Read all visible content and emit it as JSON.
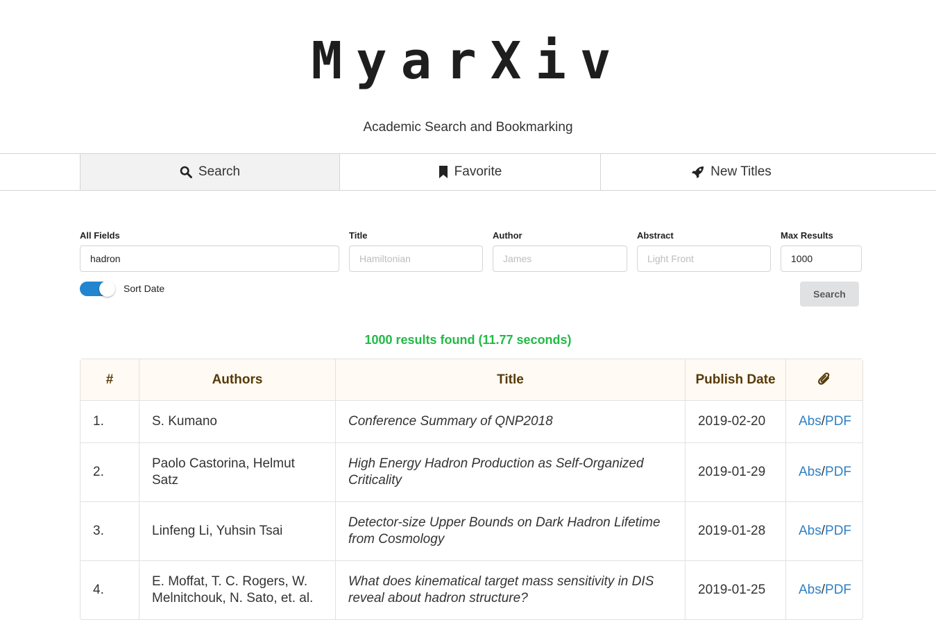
{
  "app": {
    "title": "MyarXiv",
    "tagline": "Academic Search and Bookmarking"
  },
  "nav": {
    "tabs": [
      {
        "label": "Search",
        "icon": "search-icon",
        "active": true
      },
      {
        "label": "Favorite",
        "icon": "bookmark-icon",
        "active": false
      },
      {
        "label": "New Titles",
        "icon": "rocket-icon",
        "active": false
      }
    ]
  },
  "search_form": {
    "all_fields": {
      "label": "All Fields",
      "value": "hadron",
      "placeholder": ""
    },
    "title": {
      "label": "Title",
      "value": "",
      "placeholder": "Hamiltonian"
    },
    "author": {
      "label": "Author",
      "value": "",
      "placeholder": "James"
    },
    "abstract": {
      "label": "Abstract",
      "value": "",
      "placeholder": "Light Front"
    },
    "max_results": {
      "label": "Max Results",
      "value": "1000",
      "placeholder": ""
    },
    "sort_date": {
      "label": "Sort Date",
      "enabled": true
    },
    "submit_label": "Search"
  },
  "results": {
    "status": "1000 results found (11.77 seconds)",
    "columns": [
      "#",
      "Authors",
      "Title",
      "Publish Date",
      "paperclip-icon"
    ],
    "rows": [
      {
        "num": "1.",
        "authors": "S. Kumano",
        "title": "Conference Summary of QNP2018",
        "date": "2019-02-20",
        "abs": "Abs",
        "sep": "/",
        "pdf": "PDF"
      },
      {
        "num": "2.",
        "authors": "Paolo Castorina, Helmut Satz",
        "title": "High Energy Hadron Production as Self-Organized Criticality",
        "date": "2019-01-29",
        "abs": "Abs",
        "sep": "/",
        "pdf": "PDF"
      },
      {
        "num": "3.",
        "authors": "Linfeng Li, Yuhsin Tsai",
        "title": "Detector-size Upper Bounds on Dark Hadron Lifetime from Cosmology",
        "date": "2019-01-28",
        "abs": "Abs",
        "sep": "/",
        "pdf": "PDF"
      },
      {
        "num": "4.",
        "authors": "E. Moffat, T. C. Rogers, W. Melnitchouk, N. Sato, et. al.",
        "title": "What does kinematical target mass sensitivity in DIS reveal about hadron structure?",
        "date": "2019-01-25",
        "abs": "Abs",
        "sep": "/",
        "pdf": "PDF"
      }
    ]
  },
  "colors": {
    "accent": "#2185d0",
    "link": "#2f80c4",
    "success": "#21ba45",
    "table_header_bg": "#fffaf3",
    "table_header_text": "#573a08"
  }
}
